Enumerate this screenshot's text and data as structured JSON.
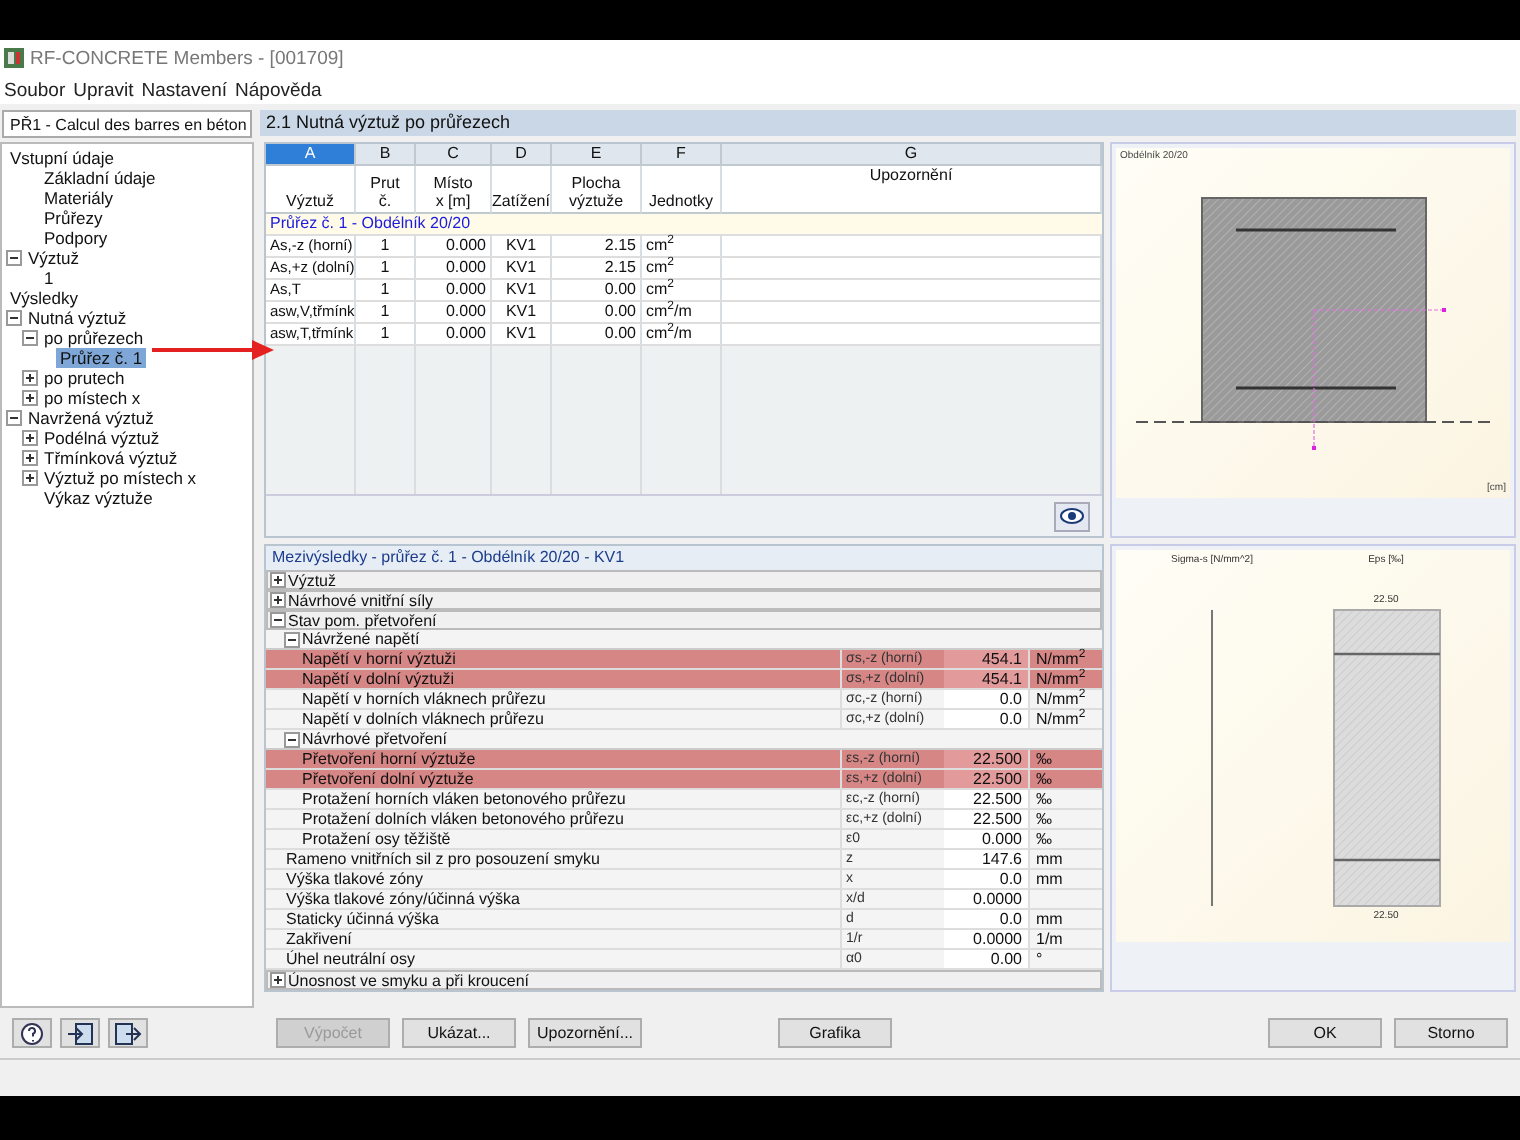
{
  "window": {
    "title": "RF-CONCRETE Members - [001709]"
  },
  "menu": [
    "Soubor",
    "Upravit",
    "Nastavení",
    "Nápověda"
  ],
  "case_selector": {
    "value": "PŘ1 - Calcul des barres en béton"
  },
  "tree": [
    {
      "label": "Vstupní údaje",
      "children": [
        {
          "label": "Základní údaje",
          "selected": false
        },
        {
          "label": "Materiály",
          "selected": false
        },
        {
          "label": "Průřezy",
          "selected": false
        },
        {
          "label": "Podpory",
          "selected": false
        }
      ],
      "selected": false
    },
    {
      "label": "Výztuž",
      "expanded": true,
      "selected": false,
      "children": [
        {
          "label": "1",
          "selected": false
        }
      ]
    },
    {
      "label": "Výsledky",
      "selected": false
    },
    {
      "label": "Nutná výztuž",
      "expanded": true,
      "selected": false,
      "children": [
        {
          "label": "po průřezech",
          "expanded": true,
          "selected": false,
          "children": [
            {
              "label": "Průřez č. 1",
              "selected": true
            }
          ]
        },
        {
          "label": "po prutech",
          "expanded": false,
          "selected": false
        },
        {
          "label": "po místech x",
          "expanded": false,
          "selected": false
        }
      ]
    },
    {
      "label": "Navržená výztuž",
      "expanded": true,
      "selected": false,
      "children": [
        {
          "label": "Podélná výztuž",
          "expanded": false,
          "selected": false
        },
        {
          "label": "Třmínková výztuž",
          "expanded": false,
          "selected": false
        },
        {
          "label": "Výztuž po místech x",
          "expanded": false,
          "selected": false
        },
        {
          "label": "Výkaz výztuže",
          "selected": false
        }
      ]
    }
  ],
  "section": {
    "title": "2.1 Nutná výztuž po průřezech"
  },
  "table": {
    "columns": [
      {
        "letter": "A",
        "header": "Výztuž",
        "selected": true
      },
      {
        "letter": "B",
        "header": "Prut\nč.",
        "selected": false
      },
      {
        "letter": "C",
        "header": "Místo\nx [m]",
        "selected": false
      },
      {
        "letter": "D",
        "header": "Zatížení",
        "selected": false
      },
      {
        "letter": "E",
        "header": "Plocha\nvýztuže",
        "selected": false
      },
      {
        "letter": "F",
        "header": "Jednotky",
        "selected": false
      },
      {
        "letter": "G",
        "header": "Upozornění",
        "selected": false
      }
    ],
    "rows": [
      {
        "kind": "group",
        "text": "Průřez č. 1 - Obdélník 20/20"
      },
      {
        "kind": "data",
        "cells": [
          "As,-z (horní)",
          "1",
          "0.000",
          "KV1",
          "2.15",
          "cm$^{2}$"
        ]
      },
      {
        "kind": "data",
        "cells": [
          "As,+z (dolní)",
          "1",
          "0.000",
          "KV1",
          "2.15",
          "cm$^{2}$"
        ]
      },
      {
        "kind": "data",
        "cells": [
          "As,T",
          "1",
          "0.000",
          "KV1",
          "0.00",
          "cm$^{2}$"
        ]
      },
      {
        "kind": "data",
        "cells": [
          "asw,V,třmínk",
          "1",
          "0.000",
          "KV1",
          "0.00",
          "cm$^{2}$/m"
        ]
      },
      {
        "kind": "data",
        "cells": [
          "asw,T,třmínk",
          "1",
          "0.000",
          "KV1",
          "0.00",
          "cm$^{2}$/m"
        ]
      }
    ]
  },
  "section_graphic": {
    "label": "Obdélník 20/20",
    "unit_label": "[cm]"
  },
  "results": {
    "title": "Mezivýsledky  -  průřez č. 1 - Obdélník 20/20  -  KV1",
    "rows": [
      {
        "kind": "group",
        "label": "Výztuž",
        "expanded": false
      },
      {
        "kind": "group",
        "label": "Návrhové vnitřní síly",
        "expanded": false
      },
      {
        "kind": "group",
        "label": "Stav pom. přetvoření",
        "expanded": true,
        "children": [
          {
            "kind": "group",
            "label": "Návržené napětí",
            "expanded": true,
            "children": [
              {
                "kind": "item",
                "label": "Napětí v horní výztuži",
                "symbol": "σs,-z (horní)",
                "value": "454.1",
                "unit": "N/mm$^{2}$",
                "highlighted": true
              },
              {
                "kind": "item",
                "label": "Napětí v dolní výztuži",
                "symbol": "σs,+z (dolní)",
                "value": "454.1",
                "unit": "N/mm$^{2}$",
                "highlighted": true
              },
              {
                "kind": "item",
                "label": "Napětí v horních vláknech průřezu",
                "symbol": "σc,-z (horní)",
                "value": "0.0",
                "unit": "N/mm$^{2}$",
                "highlighted": false
              },
              {
                "kind": "item",
                "label": "Napětí v dolních vláknech průřezu",
                "symbol": "σc,+z (dolní)",
                "value": "0.0",
                "unit": "N/mm$^{2}$",
                "highlighted": false
              }
            ]
          },
          {
            "kind": "group",
            "label": "Návrhové přetvoření",
            "expanded": true,
            "children": [
              {
                "kind": "item",
                "label": "Přetvoření horní výztuže",
                "symbol": "εs,-z (horní)",
                "value": "22.500",
                "unit": "‰",
                "highlighted": true
              },
              {
                "kind": "item",
                "label": "Přetvoření dolní výztuže",
                "symbol": "εs,+z (dolní)",
                "value": "22.500",
                "unit": "‰",
                "highlighted": true
              },
              {
                "kind": "item",
                "label": "Protažení horních vláken betonového průřezu",
                "symbol": "εc,-z (horní)",
                "value": "22.500",
                "unit": "‰",
                "highlighted": false
              },
              {
                "kind": "item",
                "label": "Protažení dolních vláken betonového průřezu",
                "symbol": "εc,+z (dolní)",
                "value": "22.500",
                "unit": "‰",
                "highlighted": false
              },
              {
                "kind": "item",
                "label": "Protažení osy těžiště",
                "symbol": "ε0",
                "value": "0.000",
                "unit": "‰",
                "highlighted": false
              }
            ]
          },
          {
            "kind": "item",
            "label": "Rameno vnitřních sil z pro posouzení smyku",
            "symbol": "z",
            "value": "147.6",
            "unit": "mm",
            "highlighted": false
          },
          {
            "kind": "item",
            "label": "Výška tlakové zóny",
            "symbol": "x",
            "value": "0.0",
            "unit": "mm",
            "highlighted": false
          },
          {
            "kind": "item",
            "label": "Výška tlakové zóny/účinná výška",
            "symbol": "x/d",
            "value": "0.0000",
            "highlighted": false
          },
          {
            "kind": "item",
            "label": "Staticky účinná výška",
            "symbol": "d",
            "value": "0.0",
            "unit": "mm",
            "highlighted": false
          },
          {
            "kind": "item",
            "label": "Zakřivení",
            "symbol": "1/r",
            "value": "0.0000",
            "unit": "1/m",
            "highlighted": false
          },
          {
            "kind": "item",
            "label": "Úhel neutrální osy",
            "symbol": "α0",
            "value": "0.00",
            "unit": "°",
            "highlighted": false
          }
        ]
      },
      {
        "kind": "group",
        "label": "Únosnost ve smyku a při kroucení",
        "expanded": false
      }
    ]
  },
  "strain_graphic": {
    "left_title": "Sigma-s [N/mm^2]",
    "right_title": "Eps [‰]",
    "top_value": "22.50",
    "bottom_value": "22.50"
  },
  "tool_buttons": [
    {
      "kind": "help"
    },
    {
      "kind": "export"
    },
    {
      "kind": "import"
    }
  ],
  "buttons": [
    {
      "label": "Výpočet",
      "disabled": true
    },
    {
      "label": "Ukázat...",
      "disabled": false
    },
    {
      "label": "Upozornění...",
      "disabled": false
    },
    {
      "label": "Grafika",
      "disabled": false
    },
    {
      "label": "OK",
      "disabled": false
    },
    {
      "label": "Storno",
      "disabled": false
    }
  ]
}
